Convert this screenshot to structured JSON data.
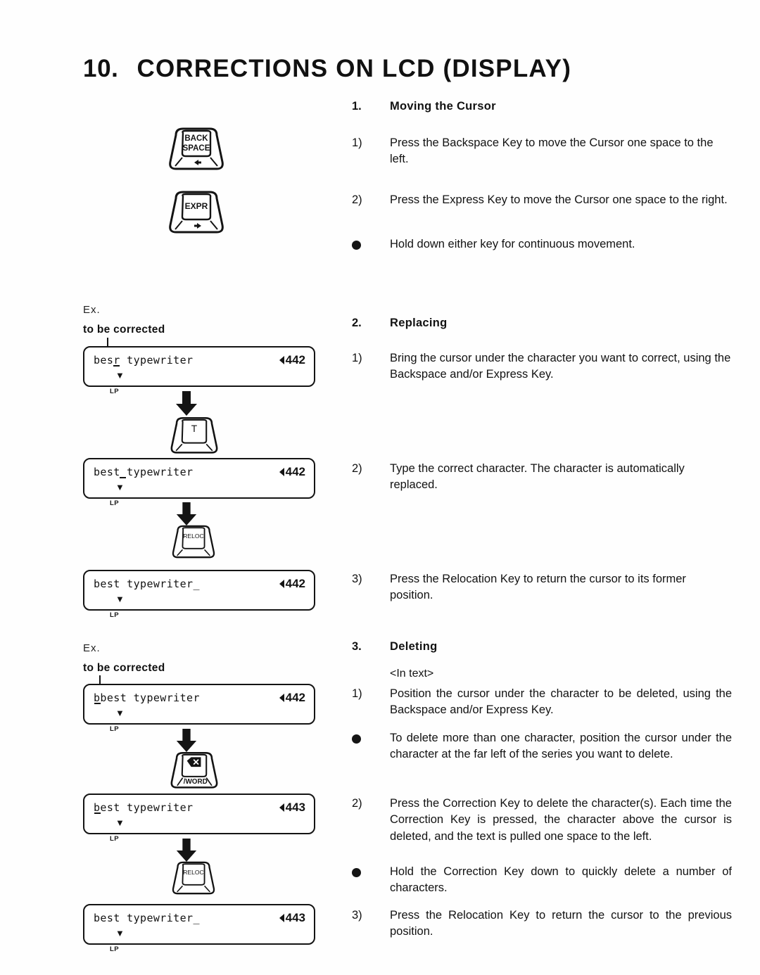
{
  "document": {
    "heading_number": "10.",
    "heading_text": "CORRECTIONS ON LCD (DISPLAY)"
  },
  "keys": {
    "backspace": {
      "line1": "BACK",
      "line2": "SPACE",
      "arrow": "left-arrow-icon"
    },
    "express": {
      "line1": "EXPR",
      "arrow": "right-arrow-icon"
    },
    "letter_t": {
      "label": "T"
    },
    "relocation": {
      "label": "RELOC"
    },
    "correction": {
      "symbol": "⌫",
      "sublabel": "/WORD"
    }
  },
  "sections": [
    {
      "number": "1.",
      "title": "Moving the Cursor",
      "items": [
        {
          "mark": "1)",
          "type": "numbered",
          "text": "Press the Backspace Key to move the Cursor one space to the left."
        },
        {
          "mark": "2)",
          "type": "numbered",
          "text": "Press the Express Key to move the Cursor one space to the right."
        },
        {
          "mark": "●",
          "type": "bullet",
          "text": "Hold down either key for continuous movement."
        }
      ]
    },
    {
      "number": "2.",
      "title": "Replacing",
      "items": [
        {
          "mark": "1)",
          "type": "numbered",
          "text": "Bring the cursor under the character you want to correct, using the Backspace and/or Express Key."
        },
        {
          "mark": "2)",
          "type": "numbered",
          "text": "Type the correct character. The character is automatically replaced."
        },
        {
          "mark": "3)",
          "type": "numbered",
          "text": "Press the Relocation Key to return the cursor to its former position."
        }
      ]
    },
    {
      "number": "3.",
      "title": "Deleting",
      "subhead": "<In text>",
      "items": [
        {
          "mark": "1)",
          "type": "numbered",
          "text": "Position the cursor under the character to be deleted, using the Backspace and/or Express Key."
        },
        {
          "mark": "●",
          "type": "bullet",
          "text": "To delete more than one character, position the cursor under the character at the far left of the series you want to delete."
        },
        {
          "mark": "2)",
          "type": "numbered",
          "text": "Press the Correction Key to delete the character(s). Each time the Correction Key is pressed, the character above the cursor is deleted, and the text is pulled one space to the left."
        },
        {
          "mark": "●",
          "type": "bullet",
          "text": "Hold the Correction Key down to quickly delete a number of characters."
        },
        {
          "mark": "3)",
          "type": "numbered",
          "text": "Press the Relocation Key to return the cursor to the previous position."
        }
      ]
    }
  ],
  "examples": [
    {
      "ex_label": "Ex.",
      "caption": "to be corrected",
      "displays": [
        {
          "text": "besr typewriter",
          "count": "442",
          "marker": "▼",
          "lp": "LP",
          "cursor_char_index": 3
        },
        {
          "text": "best typewriter",
          "count": "442",
          "marker": "▼",
          "lp": "LP",
          "cursor_char_index": 4
        },
        {
          "text": "best typewriter_",
          "count": "442",
          "marker": "▼",
          "lp": "LP",
          "cursor_char_index": -1
        }
      ]
    },
    {
      "ex_label": "Ex.",
      "caption": "to be corrected",
      "displays": [
        {
          "text": "bbest typewriter",
          "count": "442",
          "marker": "▼",
          "lp": "LP",
          "cursor_char_index": 1
        },
        {
          "text": "best typewriter",
          "count": "443",
          "marker": "▼",
          "lp": "LP",
          "cursor_char_index": 0
        },
        {
          "text": "best typewriter_",
          "count": "443",
          "marker": "▼",
          "lp": "LP",
          "cursor_char_index": -1
        }
      ]
    }
  ]
}
